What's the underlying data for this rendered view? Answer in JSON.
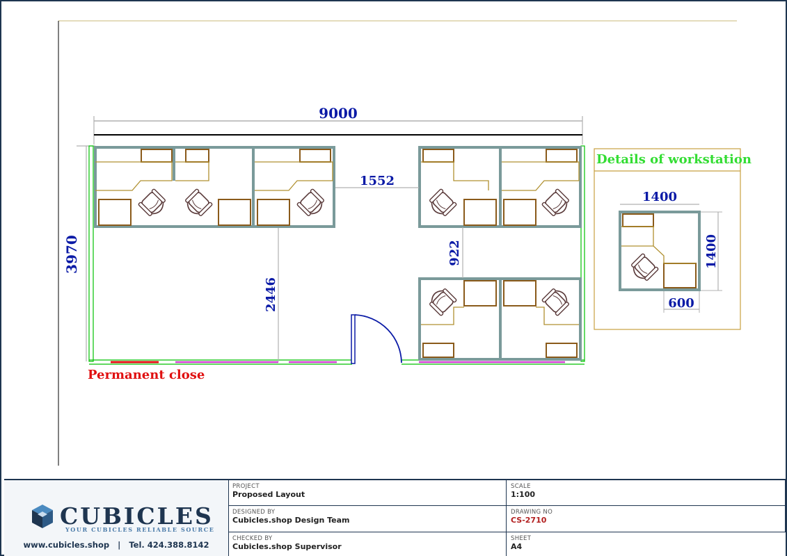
{
  "drawing": {
    "dimensions": {
      "overall_width": "9000",
      "overall_depth": "3970",
      "gap_top": "1552",
      "gap_vertical": "922",
      "aisle": "2446"
    },
    "note_permanent_close": "Permanent close",
    "detail": {
      "title": "Details of workstation",
      "width": "1400",
      "depth": "1400",
      "desk_depth": "600"
    },
    "colors": {
      "dimension_text": "#0a1aa6",
      "partition": "#7a9a9a",
      "desk": "#8a5a1a",
      "wall": "#00c000",
      "window": "#d040d0",
      "note_red": "#e01010"
    }
  },
  "titleblock": {
    "logo_word": "CUBICLES",
    "logo_tagline": "YOUR CUBICLES RELIABLE SOURCE",
    "website": "www.cubicles.shop",
    "separator": "|",
    "phone": "Tel. 424.388.8142",
    "project_label": "PROJECT",
    "project_value": "Proposed Layout",
    "scale_label": "SCALE",
    "scale_value": "1:100",
    "designed_label": "DESIGNED BY",
    "designed_value": "Cubicles.shop Design Team",
    "drawing_no_label": "DRAWING NO",
    "drawing_no_value": "CS-2710",
    "checked_label": "CHECKED BY",
    "checked_value": "Cubicles.shop Supervisor",
    "sheet_label": "SHEET",
    "sheet_value": "A4"
  }
}
